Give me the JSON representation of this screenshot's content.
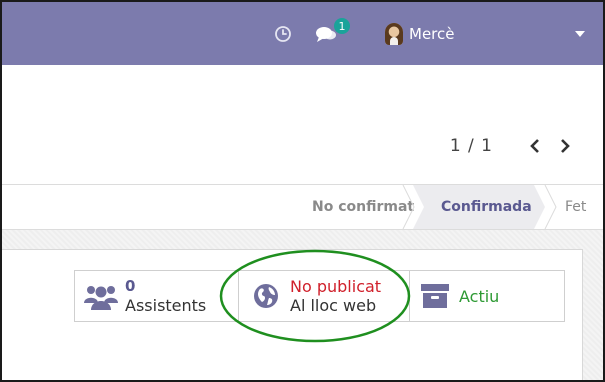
{
  "navbar": {
    "messages_badge": "1",
    "user_name": "Mercè",
    "background_color": "#7c7bad"
  },
  "pager": {
    "value": "1 / 1"
  },
  "statusbar": {
    "stages": [
      "No confirmat",
      "Confirmada",
      "Fet"
    ],
    "current_stage": "Confirmada"
  },
  "smart_buttons": {
    "attendees": {
      "value": "0",
      "label": "Assistents",
      "icon": "users-icon"
    },
    "website": {
      "status": "No publicat",
      "label": "Al lloc web",
      "icon": "globe-icon",
      "status_color": "#d0202b"
    },
    "active": {
      "label": "Actiu",
      "icon": "archive-icon",
      "label_color": "#2e9a34"
    }
  },
  "annotation_color": "#1f8f1f"
}
